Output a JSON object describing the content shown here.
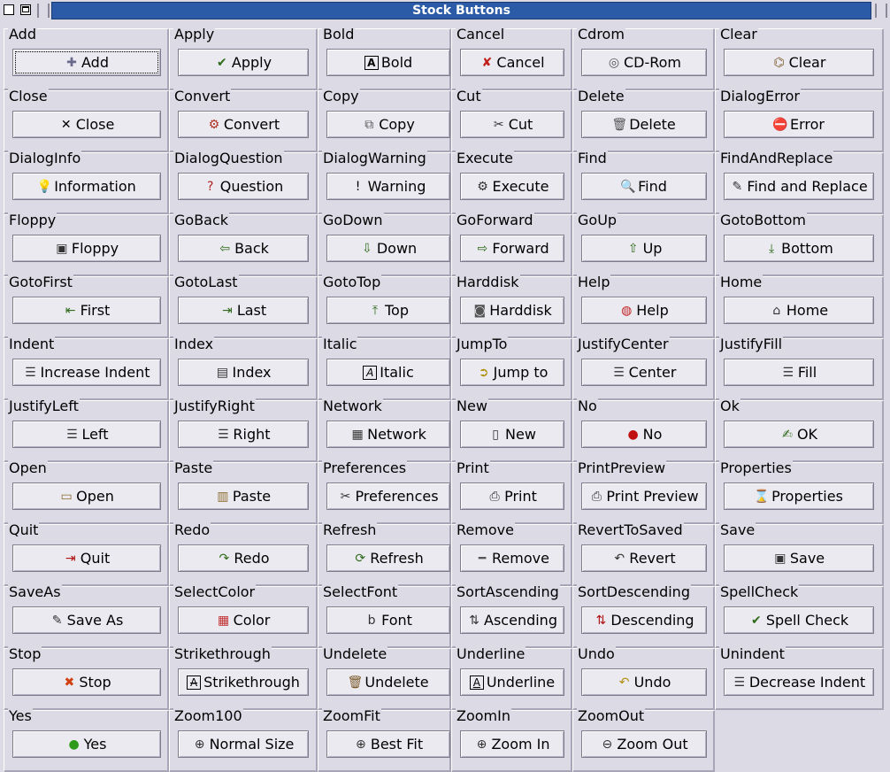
{
  "window": {
    "title": "Stock Buttons"
  },
  "cells": [
    {
      "frame": "Add",
      "label": "Add",
      "icon": "add-icon",
      "glyph": "✚",
      "color": "#6a6a8a"
    },
    {
      "frame": "Apply",
      "label": "Apply",
      "icon": "apply-check-icon",
      "glyph": "✔",
      "color": "#2e6b1a"
    },
    {
      "frame": "Bold",
      "label": "Bold",
      "icon": "bold-icon",
      "glyph": "A",
      "color": "#000"
    },
    {
      "frame": "Cancel",
      "label": "Cancel",
      "icon": "cancel-x-icon",
      "glyph": "✘",
      "color": "#c0201a"
    },
    {
      "frame": "Cdrom",
      "label": "CD-Rom",
      "icon": "cdrom-icon",
      "glyph": "◎",
      "color": "#555"
    },
    {
      "frame": "Clear",
      "label": "Clear",
      "icon": "clear-broom-icon",
      "glyph": "⌬",
      "color": "#7a5a2a"
    },
    {
      "frame": "Close",
      "label": "Close",
      "icon": "close-icon",
      "glyph": "✕",
      "color": "#000"
    },
    {
      "frame": "Convert",
      "label": "Convert",
      "icon": "convert-icon",
      "glyph": "⚙",
      "color": "#b03020"
    },
    {
      "frame": "Copy",
      "label": "Copy",
      "icon": "copy-icon",
      "glyph": "⧉",
      "color": "#555"
    },
    {
      "frame": "Cut",
      "label": "Cut",
      "icon": "scissors-icon",
      "glyph": "✂",
      "color": "#333"
    },
    {
      "frame": "Delete",
      "label": "Delete",
      "icon": "trash-icon",
      "glyph": "🗑",
      "color": "#555"
    },
    {
      "frame": "DialogError",
      "label": "Error",
      "icon": "error-icon",
      "glyph": "⛔",
      "color": "#d01010"
    },
    {
      "frame": "DialogInfo",
      "label": "Information",
      "icon": "lightbulb-icon",
      "glyph": "💡",
      "color": "#d8c060"
    },
    {
      "frame": "DialogQuestion",
      "label": "Question",
      "icon": "question-shield-icon",
      "glyph": "?",
      "color": "#b02020"
    },
    {
      "frame": "DialogWarning",
      "label": "Warning",
      "icon": "warning-icon",
      "glyph": "!",
      "color": "#000"
    },
    {
      "frame": "Execute",
      "label": "Execute",
      "icon": "execute-gears-icon",
      "glyph": "⚙",
      "color": "#333"
    },
    {
      "frame": "Find",
      "label": "Find",
      "icon": "find-icon",
      "glyph": "🔍",
      "color": "#333"
    },
    {
      "frame": "FindAndReplace",
      "label": "Find and Replace",
      "icon": "find-replace-icon",
      "glyph": "✎",
      "color": "#333"
    },
    {
      "frame": "Floppy",
      "label": "Floppy",
      "icon": "floppy-icon",
      "glyph": "▣",
      "color": "#333"
    },
    {
      "frame": "GoBack",
      "label": "Back",
      "icon": "arrow-left-icon",
      "glyph": "⇦",
      "color": "#2e6b1a"
    },
    {
      "frame": "GoDown",
      "label": "Down",
      "icon": "arrow-down-icon",
      "glyph": "⇩",
      "color": "#2e6b1a"
    },
    {
      "frame": "GoForward",
      "label": "Forward",
      "icon": "arrow-right-icon",
      "glyph": "⇨",
      "color": "#2e6b1a"
    },
    {
      "frame": "GoUp",
      "label": "Up",
      "icon": "arrow-up-icon",
      "glyph": "⇧",
      "color": "#2e6b1a"
    },
    {
      "frame": "GotoBottom",
      "label": "Bottom",
      "icon": "goto-bottom-icon",
      "glyph": "⤓",
      "color": "#2e6b1a"
    },
    {
      "frame": "GotoFirst",
      "label": "First",
      "icon": "goto-first-icon",
      "glyph": "⇤",
      "color": "#2e6b1a"
    },
    {
      "frame": "GotoLast",
      "label": "Last",
      "icon": "goto-last-icon",
      "glyph": "⇥",
      "color": "#2e6b1a"
    },
    {
      "frame": "GotoTop",
      "label": "Top",
      "icon": "goto-top-icon",
      "glyph": "⤒",
      "color": "#2e6b1a"
    },
    {
      "frame": "Harddisk",
      "label": "Harddisk",
      "icon": "harddisk-icon",
      "glyph": "◙",
      "color": "#555"
    },
    {
      "frame": "Help",
      "label": "Help",
      "icon": "lifebuoy-icon",
      "glyph": "◍",
      "color": "#c02020"
    },
    {
      "frame": "Home",
      "label": "Home",
      "icon": "home-icon",
      "glyph": "⌂",
      "color": "#333"
    },
    {
      "frame": "Indent",
      "label": "Increase Indent",
      "icon": "indent-icon",
      "glyph": "☰",
      "color": "#333"
    },
    {
      "frame": "Index",
      "label": "Index",
      "icon": "index-icon",
      "glyph": "▤",
      "color": "#333"
    },
    {
      "frame": "Italic",
      "label": "Italic",
      "icon": "italic-icon",
      "glyph": "A",
      "color": "#000"
    },
    {
      "frame": "JumpTo",
      "label": "Jump to",
      "icon": "jump-to-icon",
      "glyph": "➲",
      "color": "#b09010"
    },
    {
      "frame": "JustifyCenter",
      "label": "Center",
      "icon": "justify-center-icon",
      "glyph": "☰",
      "color": "#333"
    },
    {
      "frame": "JustifyFill",
      "label": "Fill",
      "icon": "justify-fill-icon",
      "glyph": "☰",
      "color": "#333"
    },
    {
      "frame": "JustifyLeft",
      "label": "Left",
      "icon": "justify-left-icon",
      "glyph": "☰",
      "color": "#333"
    },
    {
      "frame": "JustifyRight",
      "label": "Right",
      "icon": "justify-right-icon",
      "glyph": "☰",
      "color": "#333"
    },
    {
      "frame": "Network",
      "label": "Network",
      "icon": "network-icon",
      "glyph": "▦",
      "color": "#333"
    },
    {
      "frame": "New",
      "label": "New",
      "icon": "new-document-icon",
      "glyph": "▯",
      "color": "#333"
    },
    {
      "frame": "No",
      "label": "No",
      "icon": "no-red-ball-icon",
      "glyph": "●",
      "color": "#c01010"
    },
    {
      "frame": "Ok",
      "label": "OK",
      "icon": "ok-hand-icon",
      "glyph": "✍",
      "color": "#2e6b1a"
    },
    {
      "frame": "Open",
      "label": "Open",
      "icon": "open-folder-icon",
      "glyph": "▭",
      "color": "#8a6a2a"
    },
    {
      "frame": "Paste",
      "label": "Paste",
      "icon": "paste-clipboard-icon",
      "glyph": "▥",
      "color": "#8a6a2a"
    },
    {
      "frame": "Preferences",
      "label": "Preferences",
      "icon": "preferences-tools-icon",
      "glyph": "✂",
      "color": "#333"
    },
    {
      "frame": "Print",
      "label": "Print",
      "icon": "printer-icon",
      "glyph": "⎙",
      "color": "#333"
    },
    {
      "frame": "PrintPreview",
      "label": "Print Preview",
      "icon": "print-preview-icon",
      "glyph": "⎙",
      "color": "#333"
    },
    {
      "frame": "Properties",
      "label": "Properties",
      "icon": "properties-icon",
      "glyph": "⌛",
      "color": "#333"
    },
    {
      "frame": "Quit",
      "label": "Quit",
      "icon": "quit-door-icon",
      "glyph": "⇥",
      "color": "#b01010"
    },
    {
      "frame": "Redo",
      "label": "Redo",
      "icon": "redo-icon",
      "glyph": "↷",
      "color": "#2e6b1a"
    },
    {
      "frame": "Refresh",
      "label": "Refresh",
      "icon": "refresh-icon",
      "glyph": "⟳",
      "color": "#2e6b1a"
    },
    {
      "frame": "Remove",
      "label": "Remove",
      "icon": "remove-minus-icon",
      "glyph": "━",
      "color": "#555"
    },
    {
      "frame": "RevertToSaved",
      "label": "Revert",
      "icon": "revert-icon",
      "glyph": "↶",
      "color": "#333"
    },
    {
      "frame": "Save",
      "label": "Save",
      "icon": "save-floppy-icon",
      "glyph": "▣",
      "color": "#333"
    },
    {
      "frame": "SaveAs",
      "label": "Save As",
      "icon": "save-as-icon",
      "glyph": "✎",
      "color": "#333"
    },
    {
      "frame": "SelectColor",
      "label": "Color",
      "icon": "select-color-icon",
      "glyph": "▦",
      "color": "#c03030"
    },
    {
      "frame": "SelectFont",
      "label": "Font",
      "icon": "select-font-icon",
      "glyph": "b",
      "color": "#333"
    },
    {
      "frame": "SortAscending",
      "label": "Ascending",
      "icon": "sort-ascending-icon",
      "glyph": "⇅",
      "color": "#333"
    },
    {
      "frame": "SortDescending",
      "label": "Descending",
      "icon": "sort-descending-icon",
      "glyph": "⇅",
      "color": "#b01010"
    },
    {
      "frame": "SpellCheck",
      "label": "Spell Check",
      "icon": "spellcheck-icon",
      "glyph": "✔",
      "color": "#2e6b1a"
    },
    {
      "frame": "Stop",
      "label": "Stop",
      "icon": "stop-icon",
      "glyph": "✖",
      "color": "#d04010"
    },
    {
      "frame": "Strikethrough",
      "label": "Strikethrough",
      "icon": "strikethrough-icon",
      "glyph": "A",
      "color": "#000"
    },
    {
      "frame": "Undelete",
      "label": "Undelete",
      "icon": "undelete-icon",
      "glyph": "🗑",
      "color": "#7a5a2a"
    },
    {
      "frame": "Underline",
      "label": "Underline",
      "icon": "underline-icon",
      "glyph": "A",
      "color": "#000"
    },
    {
      "frame": "Undo",
      "label": "Undo",
      "icon": "undo-icon",
      "glyph": "↶",
      "color": "#b09010"
    },
    {
      "frame": "Unindent",
      "label": "Decrease Indent",
      "icon": "unindent-icon",
      "glyph": "☰",
      "color": "#333"
    },
    {
      "frame": "Yes",
      "label": "Yes",
      "icon": "yes-green-ball-icon",
      "glyph": "●",
      "color": "#2e9a1a"
    },
    {
      "frame": "Zoom100",
      "label": "Normal Size",
      "icon": "zoom-100-icon",
      "glyph": "⊕",
      "color": "#333"
    },
    {
      "frame": "ZoomFit",
      "label": "Best Fit",
      "icon": "zoom-fit-icon",
      "glyph": "⊕",
      "color": "#333"
    },
    {
      "frame": "ZoomIn",
      "label": "Zoom In",
      "icon": "zoom-in-icon",
      "glyph": "⊕",
      "color": "#333"
    },
    {
      "frame": "ZoomOut",
      "label": "Zoom Out",
      "icon": "zoom-out-icon",
      "glyph": "⊖",
      "color": "#333"
    }
  ]
}
